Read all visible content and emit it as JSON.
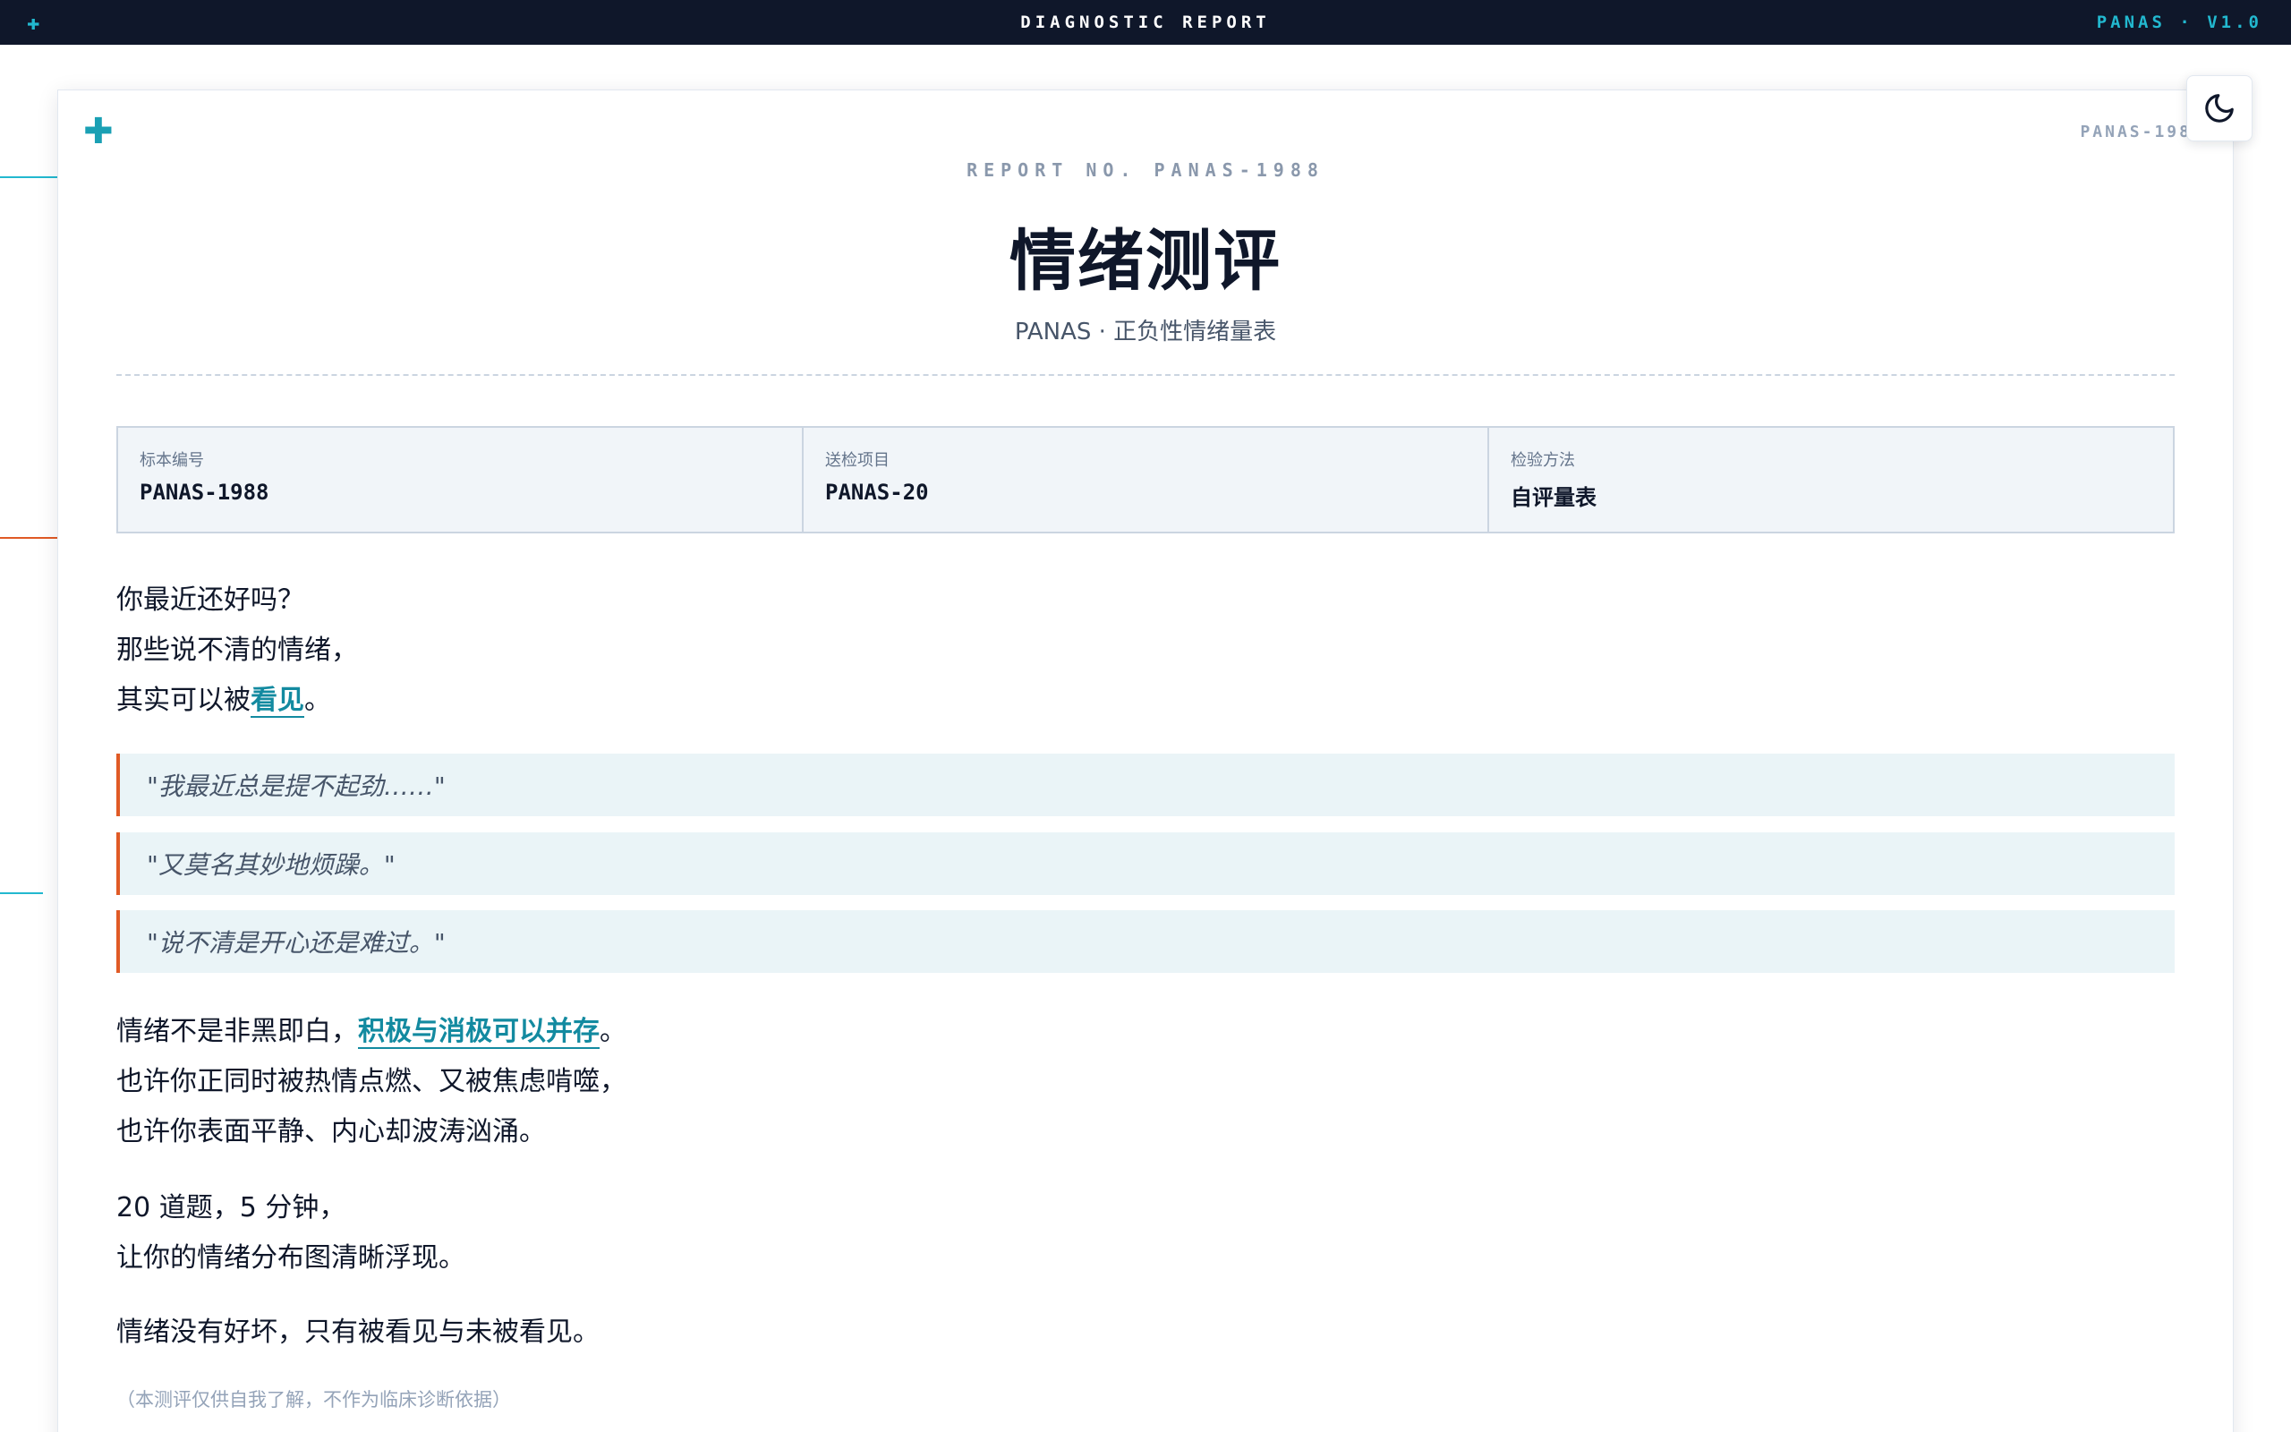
{
  "topbar": {
    "icon": "plus-icon",
    "title": "DIAGNOSTIC REPORT",
    "version": "PANAS · V1.0"
  },
  "card": {
    "corner_icon": "plus-icon",
    "code_right": "PANAS-198",
    "theme_toggle_icon": "moon-icon"
  },
  "header": {
    "report_no": "REPORT NO. PANAS-1988",
    "title": "情绪测评",
    "subtitle": "PANAS · 正负性情绪量表"
  },
  "info": [
    {
      "label": "标本编号",
      "value": "PANAS-1988"
    },
    {
      "label": "送检项目",
      "value": "PANAS-20"
    },
    {
      "label": "检验方法",
      "value": "自评量表"
    }
  ],
  "intro": {
    "line1": "你最近还好吗？",
    "line2": "那些说不清的情绪，",
    "line3_prefix": "其实可以被",
    "line3_highlight": "看见",
    "line3_suffix": "。"
  },
  "quotes": [
    "\"我最近总是提不起劲……\"",
    "\"又莫名其妙地烦躁。\"",
    "\"说不清是开心还是难过。\""
  ],
  "para2": {
    "line1_prefix": "情绪不是非黑即白，",
    "line1_highlight": "积极与消极可以并存",
    "line1_suffix": "。",
    "line2": "也许你正同时被热情点燃、又被焦虑啃噬，",
    "line3": "也许你表面平静、内心却波涛汹涌。"
  },
  "para3": {
    "line1": "20 道题，5 分钟，",
    "line2": "让你的情绪分布图清晰浮现。"
  },
  "para4": {
    "line1": "情绪没有好坏，只有被看见与未被看见。"
  },
  "footnote": "（本测评仅供自我了解，不作为临床诊断依据）",
  "colors": {
    "topbar_bg": "#0f172a",
    "accent": "#138aa0",
    "quote_border": "#e05a25"
  }
}
